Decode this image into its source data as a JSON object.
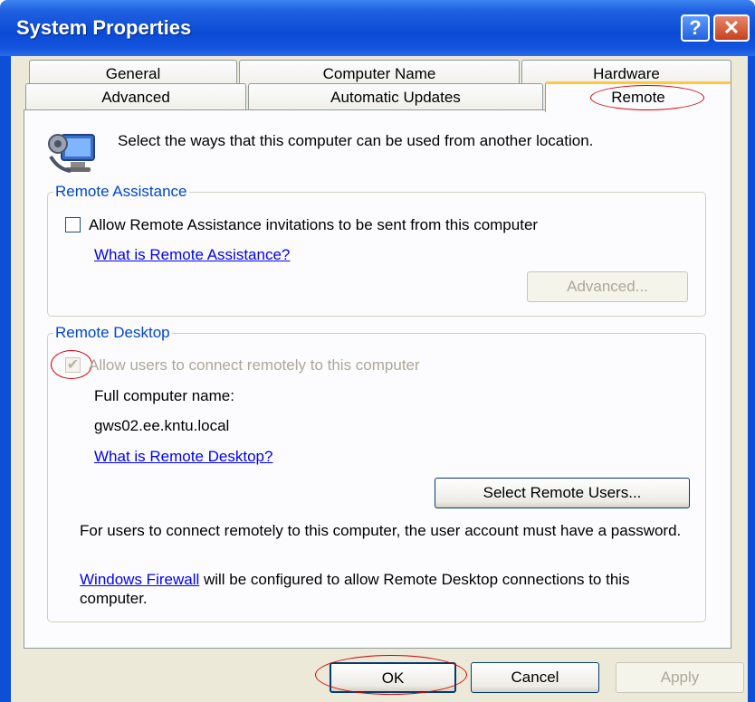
{
  "window": {
    "title": "System Properties",
    "help_label": "?",
    "close_label": "✕"
  },
  "tabs": {
    "row1": [
      "General",
      "Computer Name",
      "Hardware"
    ],
    "row2": [
      "Advanced",
      "Automatic Updates",
      "Remote"
    ],
    "active": "Remote"
  },
  "intro": {
    "text": "Select the ways that this computer can be used from another location."
  },
  "remote_assistance": {
    "legend": "Remote Assistance",
    "checkbox_label": "Allow Remote Assistance invitations to be sent from this computer",
    "checked": false,
    "help_link": "What is Remote Assistance?",
    "advanced_button": "Advanced..."
  },
  "remote_desktop": {
    "legend": "Remote Desktop",
    "checkbox_label": "Allow users to connect remotely to this computer",
    "checked": true,
    "check_glyph": "✔",
    "full_name_label": "Full computer name:",
    "full_name_value": "gws02.ee.kntu.local",
    "help_link": "What is Remote Desktop?",
    "select_users_button": "Select Remote Users...",
    "password_note": "For users to connect remotely to this computer, the user account must have a password.",
    "firewall_link": "Windows Firewall",
    "firewall_note": " will be configured to allow Remote Desktop connections to this computer."
  },
  "footer": {
    "ok": "OK",
    "cancel": "Cancel",
    "apply": "Apply"
  }
}
